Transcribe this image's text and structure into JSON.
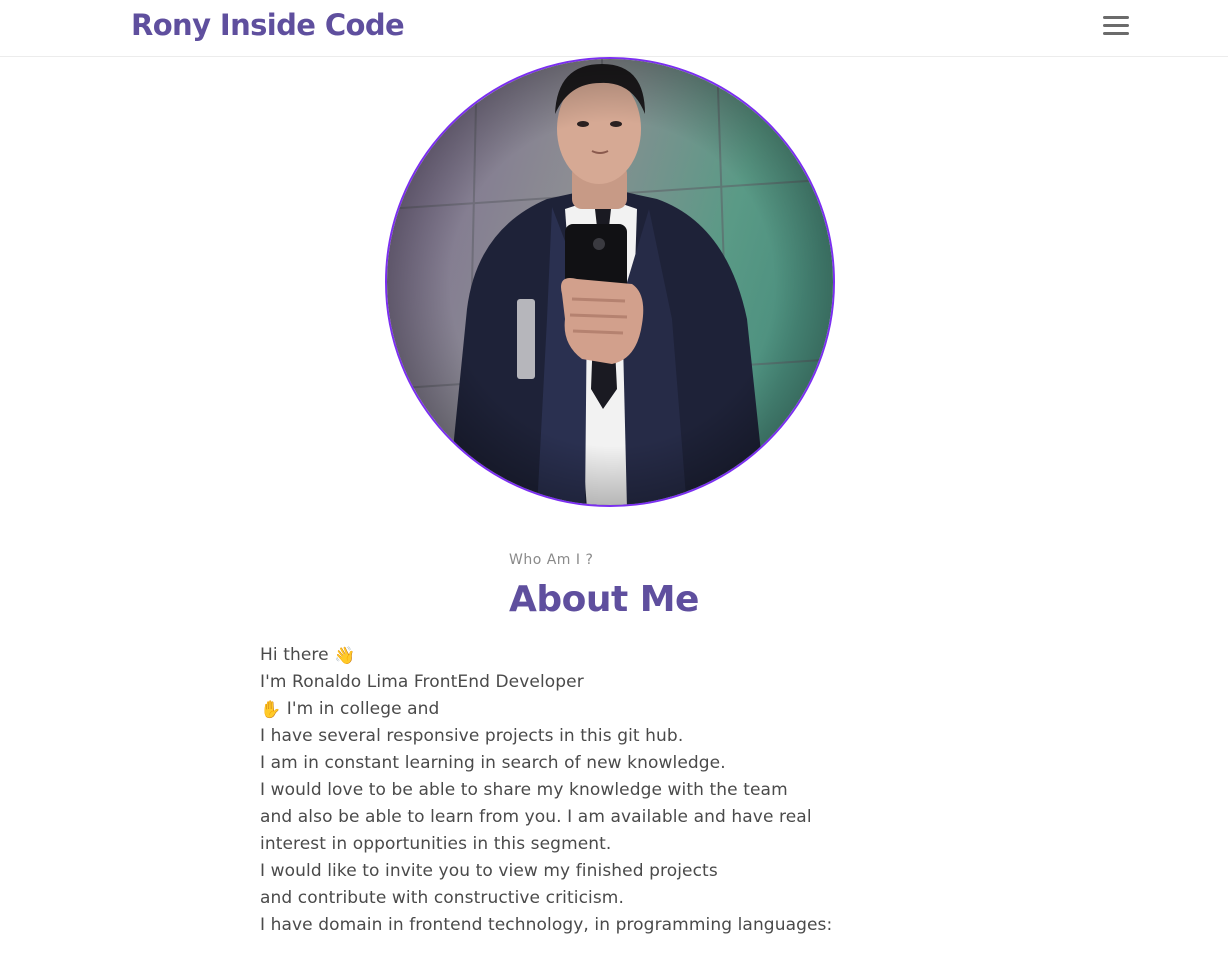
{
  "header": {
    "brand": "Rony Inside Code",
    "menu_icon": "hamburger-menu-icon"
  },
  "colors": {
    "brand": "#5f4f9e",
    "avatar_ring": "#7b2ff0",
    "text": "#4a4a4a",
    "muted": "#8a8a8a"
  },
  "about": {
    "kicker": "Who Am I ?",
    "title": "About Me",
    "lines": [
      {
        "emoji": "",
        "text": "Hi there",
        "emoji_after": "👋"
      },
      {
        "emoji": "",
        "text": "I'm Ronaldo Lima FrontEnd Developer",
        "emoji_after": ""
      },
      {
        "emoji": "✋",
        "text": "I'm in college and",
        "emoji_after": ""
      },
      {
        "emoji": "",
        "text": "I have several responsive projects in this git hub.",
        "emoji_after": ""
      },
      {
        "emoji": "",
        "text": "I am in constant learning in search of new knowledge.",
        "emoji_after": ""
      },
      {
        "emoji": "",
        "text": "I would love to be able to share my knowledge with the team",
        "emoji_after": ""
      },
      {
        "emoji": "",
        "text": "and also be able to learn from you. I am available and have real",
        "emoji_after": ""
      },
      {
        "emoji": "",
        "text": "interest in opportunities in this segment.",
        "emoji_after": ""
      },
      {
        "emoji": "",
        "text": "I would like to invite you to view my finished projects",
        "emoji_after": ""
      },
      {
        "emoji": "",
        "text": "and contribute with constructive criticism.",
        "emoji_after": ""
      },
      {
        "emoji": "",
        "text": "I have domain in frontend technology, in programming languages:",
        "emoji_after": ""
      }
    ]
  }
}
